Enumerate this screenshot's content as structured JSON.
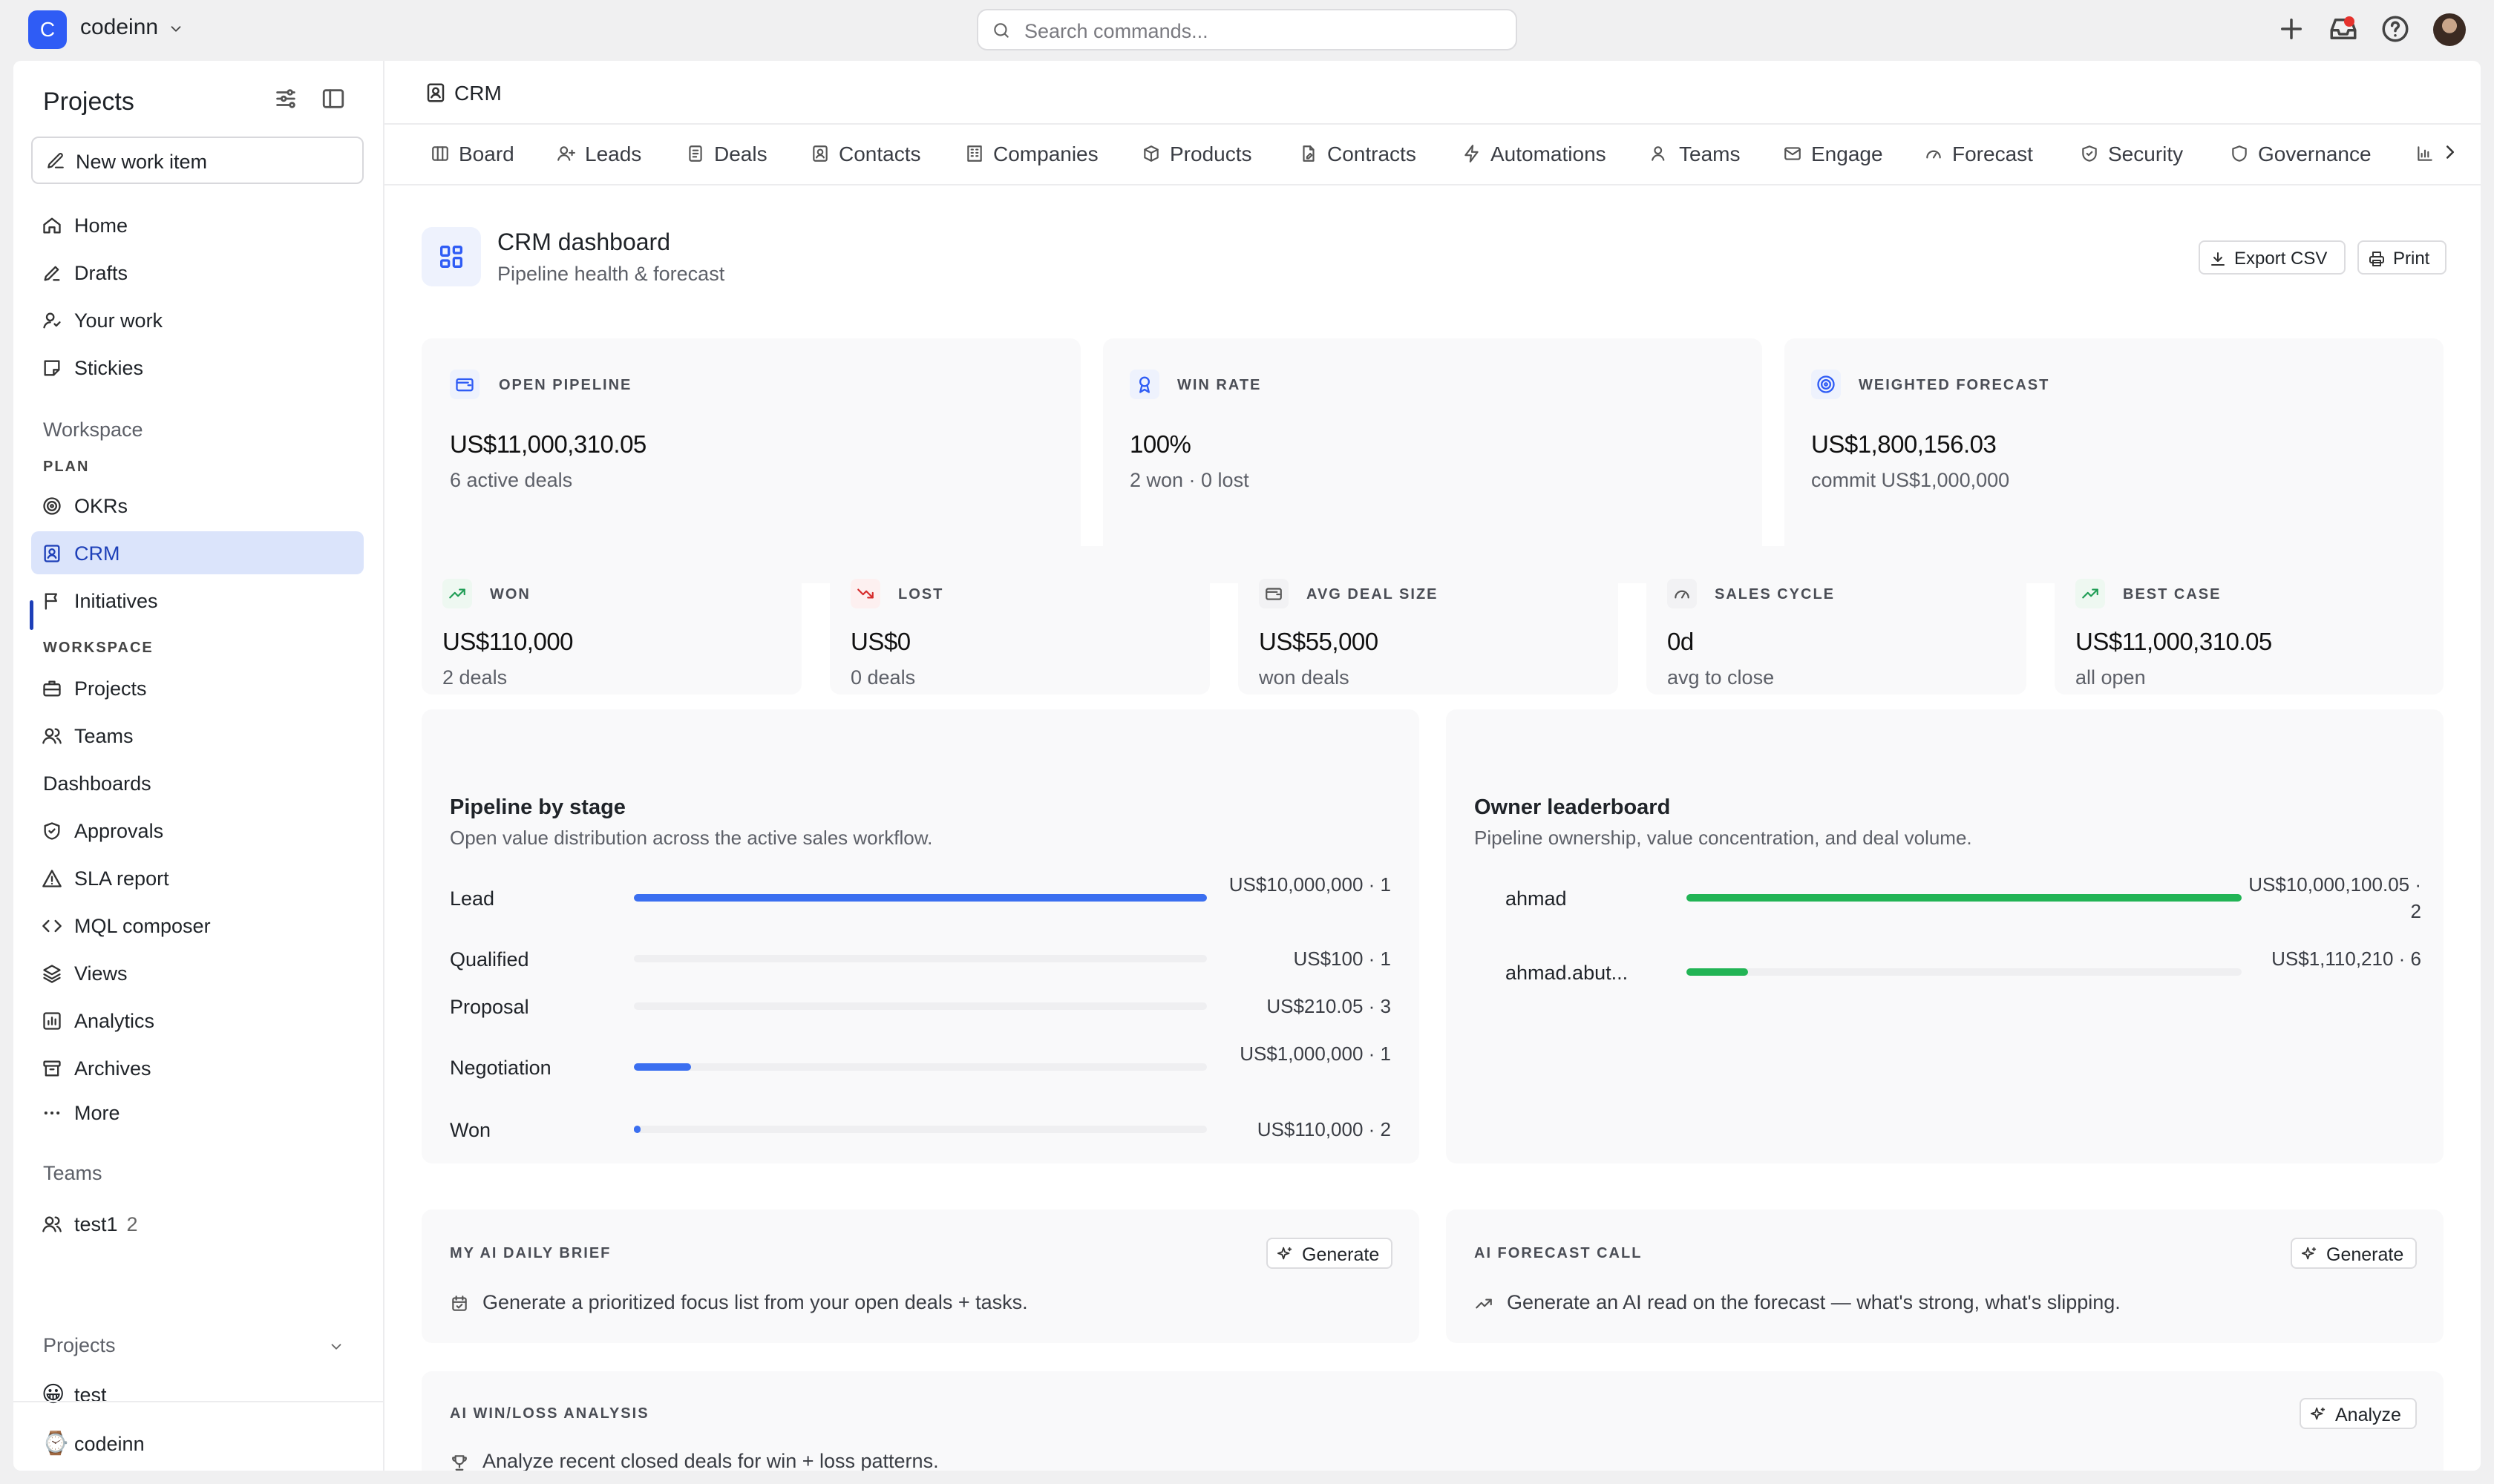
{
  "topbar": {
    "workspace_initial": "C",
    "workspace_name": "codeinn",
    "search_placeholder": "Search commands..."
  },
  "sidebar": {
    "title": "Projects",
    "new_item": "New work item",
    "top_items": [
      {
        "label": "Home",
        "icon": "home-icon"
      },
      {
        "label": "Drafts",
        "icon": "pen-icon"
      },
      {
        "label": "Your work",
        "icon": "user-icon"
      },
      {
        "label": "Stickies",
        "icon": "sticky-icon"
      }
    ],
    "workspace_heading": "Workspace",
    "plan_heading": "PLAN",
    "plan_items": [
      {
        "label": "OKRs",
        "icon": "target-icon"
      },
      {
        "label": "CRM",
        "icon": "contact-icon",
        "active": true
      },
      {
        "label": "Initiatives",
        "icon": "flag-icon"
      }
    ],
    "workspace_sub_heading": "WORKSPACE",
    "workspace_items": [
      {
        "label": "Projects",
        "icon": "briefcase-icon"
      },
      {
        "label": "Teams",
        "icon": "users-icon"
      }
    ],
    "dashboards_label": "Dashboards",
    "dashboard_items": [
      {
        "label": "Approvals",
        "icon": "shield-check-icon"
      },
      {
        "label": "SLA report",
        "icon": "warning-icon"
      },
      {
        "label": "MQL composer",
        "icon": "code-icon"
      },
      {
        "label": "Views",
        "icon": "layers-icon"
      },
      {
        "label": "Analytics",
        "icon": "chart-icon"
      },
      {
        "label": "Archives",
        "icon": "archive-icon"
      },
      {
        "label": "More",
        "icon": "more-icon"
      }
    ],
    "teams_heading": "Teams",
    "team_item": {
      "label": "test1",
      "count": "2"
    },
    "projects_heading": "Projects",
    "project_items": [
      {
        "label": "test",
        "emoji": "😀"
      },
      {
        "label": "codeinn",
        "emoji": "⌚"
      }
    ]
  },
  "main": {
    "breadcrumb": "CRM",
    "tabs": [
      {
        "label": "Board",
        "icon": "board-icon"
      },
      {
        "label": "Leads",
        "icon": "user-plus-icon"
      },
      {
        "label": "Deals",
        "icon": "document-icon"
      },
      {
        "label": "Contacts",
        "icon": "contact-icon"
      },
      {
        "label": "Companies",
        "icon": "building-icon"
      },
      {
        "label": "Products",
        "icon": "box-icon"
      },
      {
        "label": "Contracts",
        "icon": "file-pen-icon"
      },
      {
        "label": "Automations",
        "icon": "bolt-icon"
      },
      {
        "label": "Teams",
        "icon": "users-icon"
      },
      {
        "label": "Engage",
        "icon": "mail-icon"
      },
      {
        "label": "Forecast",
        "icon": "gauge-icon"
      },
      {
        "label": "Security",
        "icon": "shield-check-icon"
      },
      {
        "label": "Governance",
        "icon": "shield-icon"
      },
      {
        "label": "",
        "icon": "chart-icon"
      }
    ],
    "dashboard": {
      "title": "CRM dashboard",
      "subtitle": "Pipeline health & forecast",
      "export_label": "Export CSV",
      "print_label": "Print"
    },
    "kpis_top": [
      {
        "label": "OPEN PIPELINE",
        "value": "US$11,000,310.05",
        "sub": "6 active deals",
        "icon": "wallet-icon"
      },
      {
        "label": "WIN RATE",
        "value": "100%",
        "sub": "2 won · 0 lost",
        "icon": "award-icon"
      },
      {
        "label": "WEIGHTED FORECAST",
        "value": "US$1,800,156.03",
        "sub": "commit US$1,000,000",
        "icon": "target-icon"
      }
    ],
    "kpis_bottom": [
      {
        "label": "WON",
        "value": "US$110,000",
        "sub": "2 deals",
        "icon": "trend-up-icon",
        "color": "#1f9d55"
      },
      {
        "label": "LOST",
        "value": "US$0",
        "sub": "0 deals",
        "icon": "trend-down-icon",
        "color": "#d62b2b"
      },
      {
        "label": "AVG DEAL SIZE",
        "value": "US$55,000",
        "sub": "won deals",
        "icon": "wallet-icon",
        "color": "#555555"
      },
      {
        "label": "SALES CYCLE",
        "value": "0d",
        "sub": "avg to close",
        "icon": "gauge-icon",
        "color": "#555555"
      },
      {
        "label": "BEST CASE",
        "value": "US$11,000,310.05",
        "sub": "all open",
        "icon": "trend-up-icon",
        "color": "#1f9d55"
      }
    ],
    "pipeline": {
      "title": "Pipeline by stage",
      "subtitle": "Open value distribution across the active sales workflow.",
      "bar_color": "#3b6ff0",
      "rows": [
        {
          "stage": "Lead",
          "value_text": "US$10,000,000 · 1",
          "fraction": 1.0
        },
        {
          "stage": "Qualified",
          "value_text": "US$100 · 1",
          "fraction": 0.0
        },
        {
          "stage": "Proposal",
          "value_text": "US$210.05 · 3",
          "fraction": 0.0
        },
        {
          "stage": "Negotiation",
          "value_text": "US$1,000,000 · 1",
          "fraction": 0.1
        },
        {
          "stage": "Won",
          "value_text": "US$110,000 · 2",
          "fraction": 0.011
        }
      ]
    },
    "leaderboard": {
      "title": "Owner leaderboard",
      "subtitle": "Pipeline ownership, value concentration, and deal volume.",
      "bar_color": "#22b455",
      "rows": [
        {
          "owner": "ahmad",
          "value_text": "US$10,000,100.05 · 2",
          "fraction": 1.0
        },
        {
          "owner": "ahmad.abut...",
          "value_text": "US$1,110,210 · 6",
          "fraction": 0.111
        }
      ]
    },
    "ai_brief": {
      "label": "MY AI DAILY BRIEF",
      "button": "Generate",
      "text": "Generate a prioritized focus list from your open deals + tasks."
    },
    "ai_forecast": {
      "label": "AI FORECAST CALL",
      "button": "Generate",
      "text": "Generate an AI read on the forecast — what's strong, what's slipping."
    },
    "ai_winloss": {
      "label": "AI WIN/LOSS ANALYSIS",
      "button": "Analyze",
      "text": "Analyze recent closed deals for win + loss patterns."
    }
  }
}
